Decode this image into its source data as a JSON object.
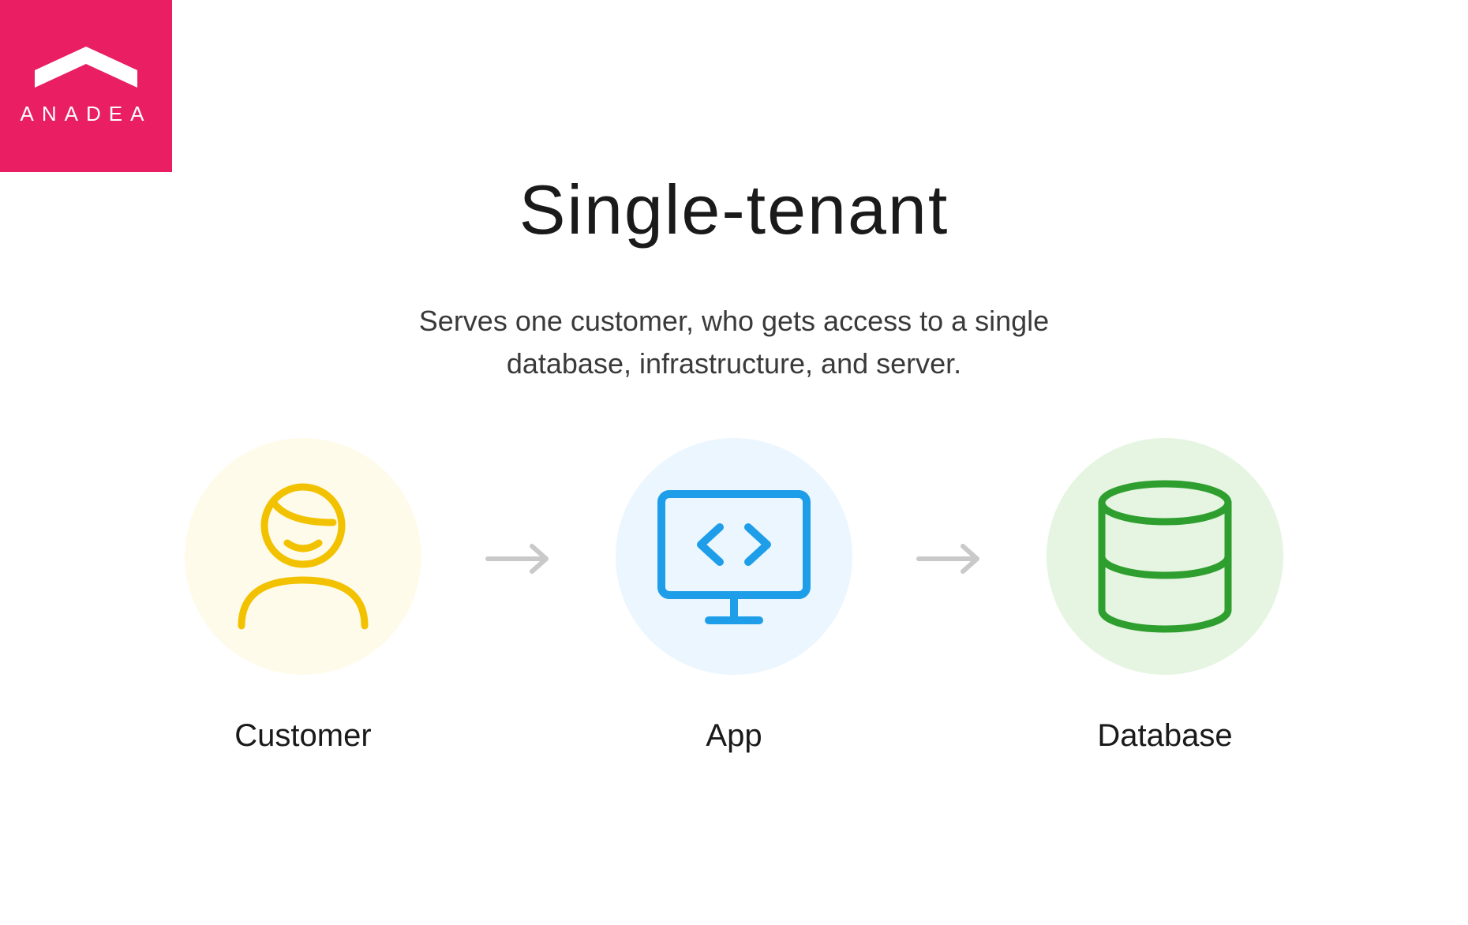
{
  "brand": {
    "name": "ANADEA",
    "color": "#e91e63"
  },
  "title": "Single-tenant",
  "subtitle": "Serves one customer, who gets access to a single database, infrastructure, and server.",
  "diagram": {
    "nodes": [
      {
        "id": "customer",
        "label": "Customer",
        "icon": "customer-icon",
        "bg": "#fffbeb",
        "stroke": "#f2c200"
      },
      {
        "id": "app",
        "label": "App",
        "icon": "app-icon",
        "bg": "#ebf6ff",
        "stroke": "#1e9ee8"
      },
      {
        "id": "database",
        "label": "Database",
        "icon": "database-icon",
        "bg": "#e5f5e1",
        "stroke": "#2e9e2e"
      }
    ],
    "arrow_color": "#c9c9c9"
  }
}
